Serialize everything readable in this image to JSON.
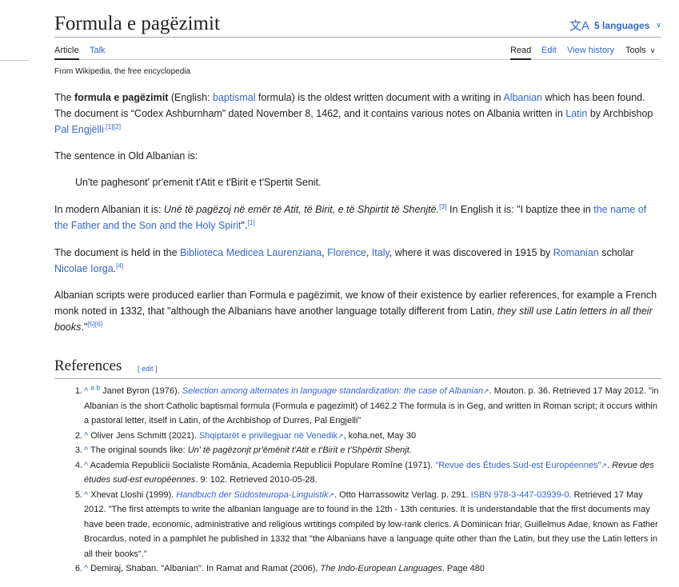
{
  "page": {
    "title": "Formula e pagëzimit",
    "languages_label": "5 languages",
    "tagline": "From Wikipedia, the free encyclopedia"
  },
  "tabs": {
    "article": "Article",
    "talk": "Talk",
    "read": "Read",
    "edit": "Edit",
    "view_history": "View history",
    "tools": "Tools"
  },
  "body": {
    "p1": {
      "t1": "The ",
      "bold": "formula e pagëzimit",
      "t2": " (English: ",
      "link_baptismal": "baptismal",
      "t3": " formula) is the oldest written document with a writing in ",
      "link_albanian": "Albanian",
      "t4": " which has been found. The document is “Codex Ashburnham” dated November 8, 1462, and it contains various notes on Albania written in ",
      "link_latin": "Latin",
      "t5": " by Archbishop ",
      "link_pal": "Pal Engjëlli",
      "sup": ".[1][2]"
    },
    "p2": "The sentence in Old Albanian is:",
    "quote": "Un'te paghesont' pr'emenit t'Atit e t'Birit e t'Spertit Senit.",
    "p3": {
      "t1": "In modern Albanian it is: ",
      "italic": "Unë të pagëzoj në emër të Atit, të Birit, e të Shpirtit të Shenjtë.",
      "sup1": "[3]",
      "t2": " In English it is: \"I baptize thee in ",
      "link": "the name of the Father and the Son and the Holy Spirit",
      "t3": "\".",
      "sup2": "[1]"
    },
    "p4": {
      "t1": "The document is held in the ",
      "link_biblioteca": "Biblioteca Medicea Laurenziana",
      "comma1": ", ",
      "link_florence": "Florence",
      "comma2": ", ",
      "link_italy": "Italy",
      "t2": ", where it was discovered in 1915 by ",
      "link_romanian": "Romanian",
      "t3": " scholar ",
      "link_iorga": "Nicolae Iorga",
      "t4": ".",
      "sup": "[4]"
    },
    "p5": {
      "t1": "Albanian scripts were produced earlier than Formula e pagëzimit, we know of their existence by earlier references, for example a French monk noted in 1332, that \"although the Albanians have another language totally different from Latin, ",
      "italic": "they still use Latin letters in all their books",
      "t2": ".\"",
      "sup": "[5][6]"
    }
  },
  "references": {
    "heading": "References",
    "edit_open": "[ ",
    "edit_label": "edit",
    "edit_close": " ]",
    "items": [
      {
        "num": "1.",
        "caret": "^",
        "ab": "a b",
        "t1": " Janet Byron (1976). ",
        "link": "Selection among alternates in language standardization: the case of Albanian",
        "t2": ". Mouton. p. 36. Retrieved 17 May 2012. \"in Albanian is the short Catholic baptismal formula (Formula e pagezimit) of 1462.2 The formula is in Geg, and written in Roman script; it occurs within a pastoral letter, itself in Latin, of the Archbishop of Durres, Pal Engjelli\""
      },
      {
        "num": "2.",
        "caret": "^",
        "t1": " Oliver Jens Schmitt (2021). ",
        "link": "Shqiptarët e privilegjuar në Venedik",
        "t2": ", koha.net, May 30"
      },
      {
        "num": "3.",
        "caret": "^",
        "t1": " The original sounds like: ",
        "italic": "Un' të pagëzonjt pr'ëmënit t'Atit e t'Birit e t'Shpërtit Shenjt."
      },
      {
        "num": "4.",
        "caret": "^",
        "t1": " Academia Republicii Socialiste România, Academia Republicii Populare Romîne (1971). ",
        "link": "\"Revue des Études Sud-est Européennes\"",
        "t2": ". ",
        "italic": "Revue des études sud-est européennes",
        "t3": ". 9: 102. Retrieved 2010-05-28."
      },
      {
        "num": "5.",
        "caret": "^",
        "t1": " Xhevat Lloshi (1999). ",
        "link": "Handbuch der Südosteuropa-Linguistik",
        "t2": ". Otto Harrassowitz Verlag. p. 291. ",
        "link2": "ISBN 978-3-447-03939-0",
        "t3": ". Retrieved 17 May 2012. \"The first attempts to write the albanian language are to found in the 12th - 13th centuries. It is understandable that the first documents may have been trade, economic, administrative and religious wrtitings compiled by low-rank clerics. A Dominican friar, Guillelmus Adae, known as Father Brocardus, noted in a pamphlet he published in 1332 that \"the Albanians have a language quite other than the Latin, but they use the Latin letters in all their books\".\""
      },
      {
        "num": "6.",
        "caret": "^",
        "t1": " Demiraj, Shaban. \"Albanian\". In Ramat and Ramat (2006), ",
        "italic": "The Indo-European Languages",
        "t2": ". Page 480"
      }
    ]
  },
  "icons": {
    "translate": "文A",
    "chevron": "∨",
    "external": "↗"
  }
}
